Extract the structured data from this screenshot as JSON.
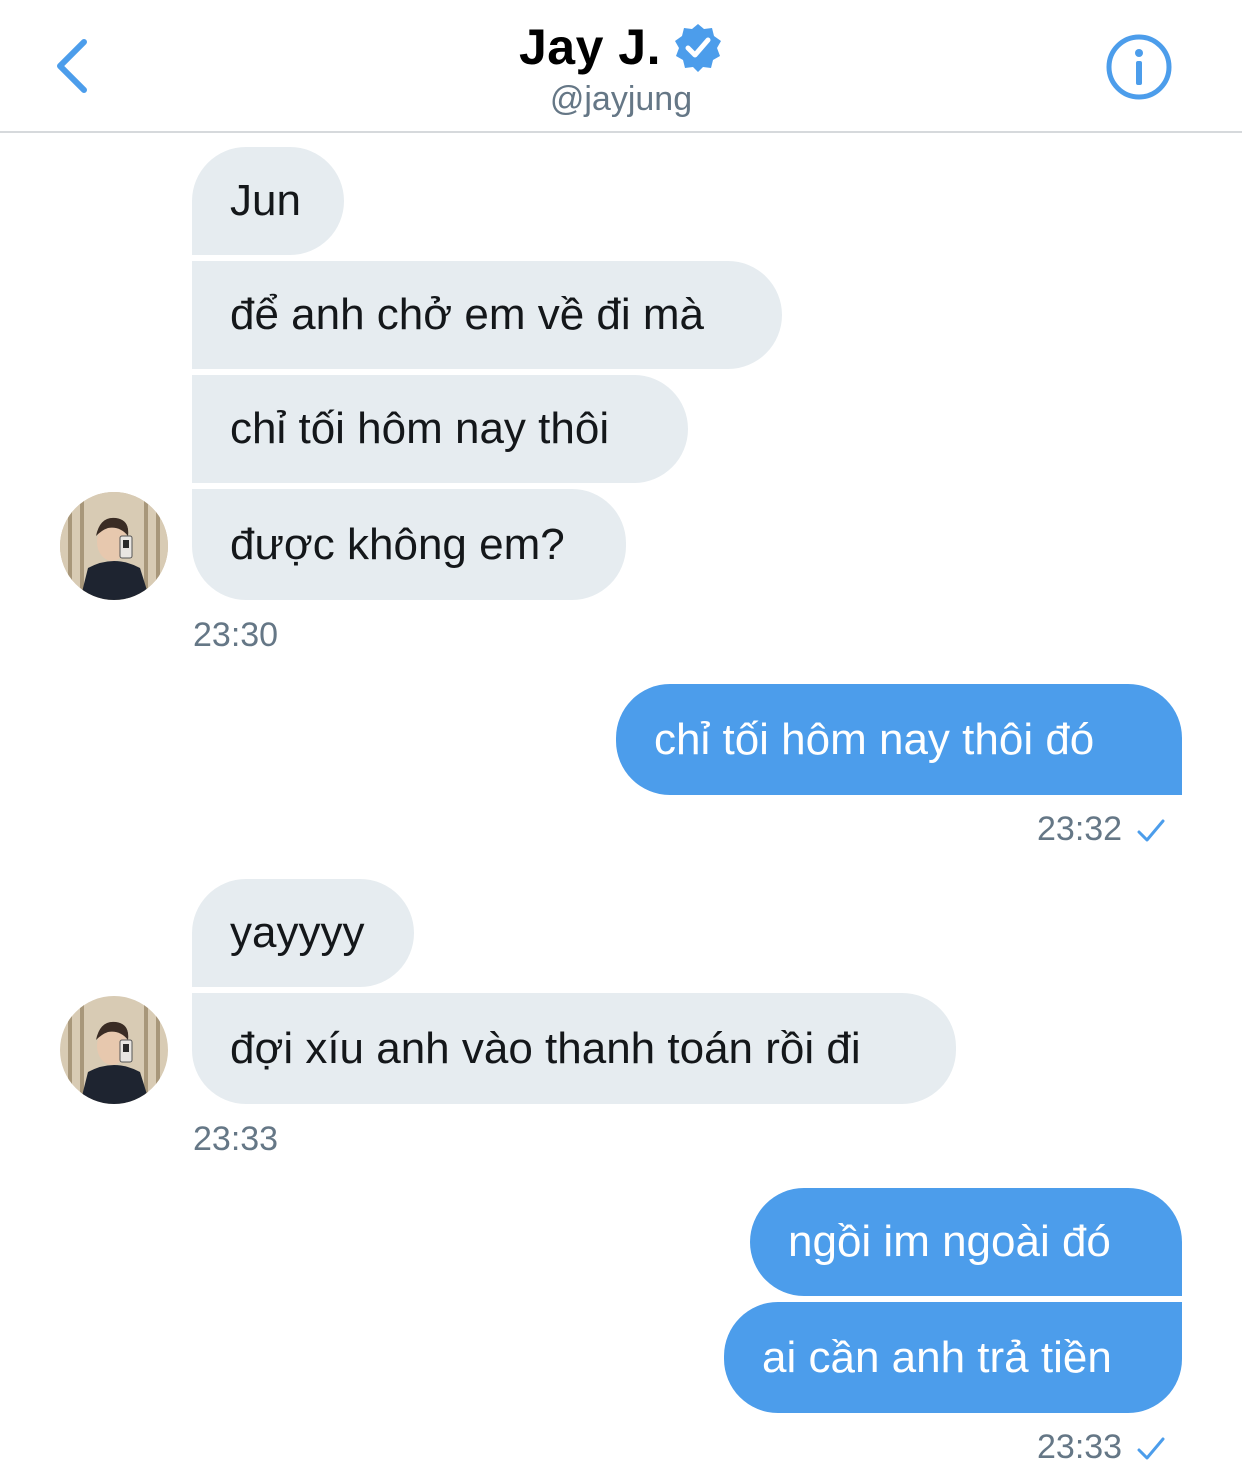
{
  "header": {
    "display_name": "Jay J.",
    "handle": "@jayjung",
    "verified_icon": "verified-badge-icon",
    "back_icon": "chevron-left-icon",
    "info_icon": "info-icon"
  },
  "colors": {
    "accent": "#4c9deb",
    "incoming_bubble": "#e6ecf0",
    "timestamp": "#657786"
  },
  "messages": {
    "group1": {
      "m1": "Jun",
      "m2": "để anh chở em về đi mà",
      "m3": "chỉ tối hôm nay thôi",
      "m4": "được không em?",
      "time": "23:30"
    },
    "reply1": {
      "m1": "chỉ tối hôm nay thôi đó",
      "time": "23:32"
    },
    "group2": {
      "m1": "yayyyy",
      "m2": "đợi xíu anh vào thanh toán rồi đi",
      "time": "23:33"
    },
    "reply2": {
      "m1": "ngồi im ngoài đó",
      "m2": "ai cần anh trả tiền",
      "time": "23:33"
    }
  }
}
